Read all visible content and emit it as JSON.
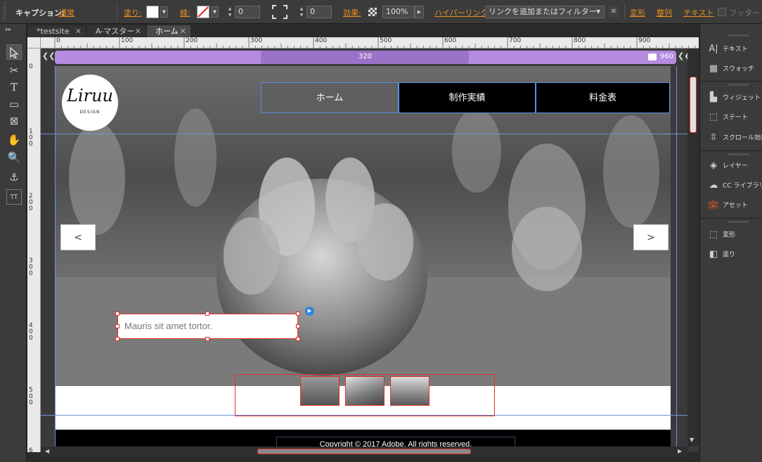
{
  "controlbar": {
    "caption_label": "キャプション:",
    "caption_value": "通常",
    "fill_label": "塗り:",
    "stroke_label": "線:",
    "stroke_width": "0",
    "corner_value": "0",
    "effects_label": "効果:",
    "opacity": "100%",
    "hyperlink_label": "ハイパーリンク:",
    "hyperlink_placeholder": "リンクを追加またはフィルター",
    "transform_link": "変形",
    "align_link": "整列",
    "text_link": "テキスト",
    "footer_label": "フッター"
  },
  "tabs": [
    {
      "label": "*testsite"
    },
    {
      "label": "A-マスター"
    },
    {
      "label": "ホーム"
    }
  ],
  "ruler": {
    "h_ticks": [
      "0",
      "100",
      "200",
      "300",
      "400",
      "500",
      "600",
      "700",
      "800",
      "900"
    ],
    "v_ticks": [
      "0",
      "100",
      "200",
      "300",
      "400",
      "500",
      "6"
    ]
  },
  "breakpoints": {
    "mobile": "320",
    "desktop": "960"
  },
  "logo": {
    "name": "Liruu",
    "sub": "DESIGN"
  },
  "nav": [
    {
      "label": "ホーム"
    },
    {
      "label": "制作実績"
    },
    {
      "label": "料金表"
    }
  ],
  "slideshow": {
    "prev": "<",
    "next": ">",
    "caption": "Mauris sit amet tortor."
  },
  "footer": {
    "copyright": "Copyright © 2017 Adobe. All rights reserved."
  },
  "panels": {
    "group1": [
      "テキスト",
      "スウォッチ"
    ],
    "group2": [
      "ウィジェット",
      "ステート",
      "スクロール効果"
    ],
    "group3": [
      "レイヤー",
      "CC ライブラリ",
      "アセット"
    ],
    "group4": [
      "変形",
      "塗り"
    ]
  },
  "colors": {
    "accent_orange": "#e8901e",
    "selection_red": "#e0302a",
    "guide_blue": "#6a95d8",
    "breakpoint_purple": "#b48be0"
  }
}
